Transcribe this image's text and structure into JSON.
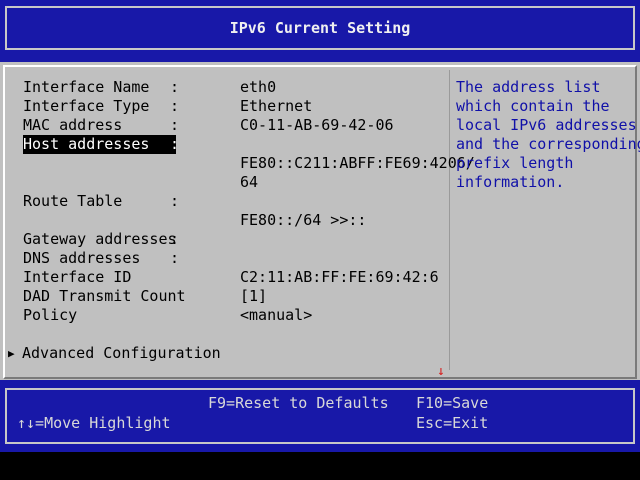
{
  "title": "IPv6 Current Setting",
  "rows": [
    {
      "label": "Interface Name",
      "value": "eth0"
    },
    {
      "label": "Interface Type",
      "value": "Ethernet"
    },
    {
      "label": "MAC address",
      "value": "C0-11-AB-69-42-06"
    },
    {
      "label": "Host addresses",
      "value": "FE80::C211:ABFF:FE69:4206/",
      "value2": "64"
    },
    {
      "label": "Route Table",
      "value": "FE80::/64 >>::"
    },
    {
      "label": "Gateway addresses",
      "value": ""
    },
    {
      "label": "DNS addresses",
      "value": ""
    },
    {
      "label": "Interface ID",
      "value": "C2:11:AB:FF:FE:69:42:6"
    },
    {
      "label": "DAD Transmit Count",
      "value": "[1]"
    },
    {
      "label": "Policy",
      "value": "<manual>"
    }
  ],
  "colon": ":",
  "submenu": {
    "label": "Advanced Configuration"
  },
  "help_text": [
    "The address list",
    "which contain the",
    "local IPv6 addresses",
    "and the corresponding",
    "prefix length",
    "information."
  ],
  "footer": {
    "reset": "F9=Reset to Defaults",
    "save": "F10=Save",
    "move": "↑↓=Move Highlight",
    "exit": "Esc=Exit"
  },
  "selected_row": "Host addresses",
  "colors": {
    "title_bg": "#1818a8",
    "main_bg": "#c0c0c0",
    "help_text": "#1010a8",
    "highlight_bg": "#000000",
    "scroll_arrow": "#d81818"
  }
}
